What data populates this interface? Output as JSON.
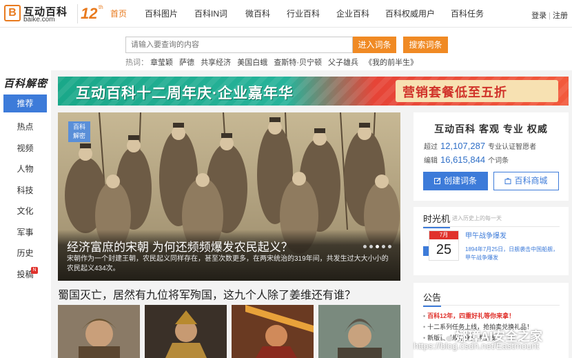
{
  "brand": {
    "logo_glyph": "B",
    "name": "互动百科",
    "domain": "baike.com",
    "anniversary_number": "12",
    "anniversary_suffix": "th",
    "accent_color": "#e87a1e"
  },
  "nav": {
    "items": [
      "首页",
      "百科图片",
      "百科IN词",
      "微百科",
      "行业百科",
      "企业百科",
      "百科权威用户",
      "百科任务"
    ],
    "active_index": 0
  },
  "auth": {
    "login": "登录",
    "separator": "|",
    "register": "注册"
  },
  "search": {
    "placeholder": "请输入要查询的内容",
    "enter_button": "进入词条",
    "search_button": "搜索词条",
    "hot_label": "热词：",
    "hot_words": [
      "章莹颖",
      "萨德",
      "共享经济",
      "美国白蛾",
      "查斯特·贝宁顿",
      "父子雄兵",
      "《我的前半生》"
    ]
  },
  "sidebar": {
    "title": "百科解密",
    "items": [
      {
        "label": "推荐",
        "active": true
      },
      {
        "label": "热点"
      },
      {
        "label": "视频"
      },
      {
        "label": "人物"
      },
      {
        "label": "科技"
      },
      {
        "label": "文化"
      },
      {
        "label": "军事"
      },
      {
        "label": "历史"
      },
      {
        "label": "投稿",
        "badge": "N"
      }
    ]
  },
  "banner": {
    "title": "互动百科十二周年庆·企业嘉年华",
    "subtitle": "营销套餐低至五折"
  },
  "hero": {
    "tag_line1": "百科",
    "tag_line2": "解密",
    "title": "经济富庶的宋朝 为何还频频爆发农民起义？",
    "description": "宋朝作为一个封建王朝，农民起义同样存在，甚至次数更多，在两宋统治的319年间，共发生过大大小小的农民起义434次。",
    "slide_count": 5,
    "active_slide": 2
  },
  "article": {
    "title": "蜀国灭亡，居然有九位将军殉国，这九个人除了姜维还有谁？"
  },
  "stats": {
    "slogan": "互动百科 客观 专业 权威",
    "over_label": "超过",
    "contributors": "12,107,287",
    "contributors_suffix": "专业认证智愿者",
    "edit_label": "编辑",
    "entries": "16,615,844",
    "entries_suffix": "个词条",
    "create_button": "创建词条",
    "mall_button": "百科商城"
  },
  "time_machine": {
    "title": "时光机",
    "subtitle": "进入历史上的每一天",
    "month": "7月",
    "day": "25",
    "headline": "甲午战争爆发",
    "text": "1894年7月25日，日舰袭击中国船舰，甲午战争爆发"
  },
  "notice": {
    "title": "公告",
    "items": [
      "百科12年，四重好礼等你来拿！",
      "十二系列任务上线，抢拍卖兑换礼品！",
      "新版百科规范化正式上线"
    ]
  },
  "watermark": {
    "text": "娜璋AI安全之家",
    "url": "https://blog.csdn.net/Eastmount"
  }
}
